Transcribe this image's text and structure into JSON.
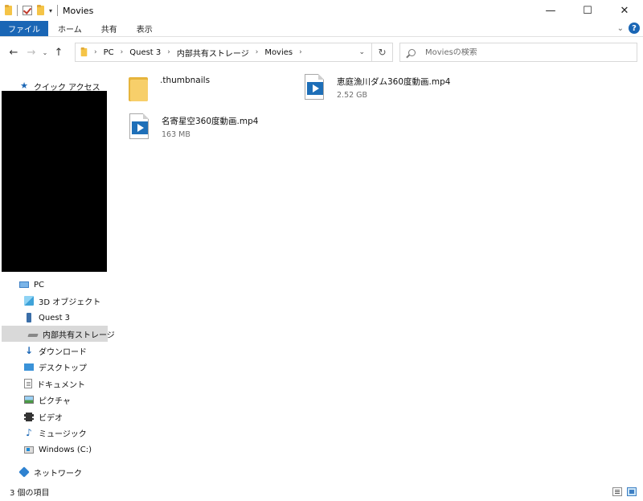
{
  "window": {
    "title": "Movies",
    "minimize_glyph": "—",
    "maximize_glyph": "☐",
    "close_glyph": "✕"
  },
  "ribbon": {
    "tabs": [
      {
        "label": "ファイル"
      },
      {
        "label": "ホーム"
      },
      {
        "label": "共有"
      },
      {
        "label": "表示"
      }
    ],
    "help_glyph": "?"
  },
  "address": {
    "crumbs": [
      "PC",
      "Quest 3",
      "内部共有ストレージ",
      "Movies"
    ]
  },
  "search": {
    "placeholder": "Moviesの検索"
  },
  "sidebar": {
    "quick_access": "クイック アクセス",
    "pc": "PC",
    "objects3d": "3D オブジェクト",
    "quest": "Quest 3",
    "internal_storage": "内部共有ストレージ",
    "downloads": "ダウンロード",
    "desktop": "デスクトップ",
    "documents": "ドキュメント",
    "pictures": "ピクチャ",
    "videos": "ビデオ",
    "music": "ミュージック",
    "windows_c": "Windows (C:)",
    "network": "ネットワーク"
  },
  "files": [
    {
      "name": ".thumbnails",
      "size": "",
      "icon": "folder-icon"
    },
    {
      "name": "恵庭漁川ダム360度動画.mp4",
      "size": "2.52 GB",
      "icon": "video-file-icon"
    },
    {
      "name": "名寄星空360度動画.mp4",
      "size": "163 MB",
      "icon": "video-file-icon"
    }
  ],
  "status": {
    "count": "3 個の項目"
  }
}
